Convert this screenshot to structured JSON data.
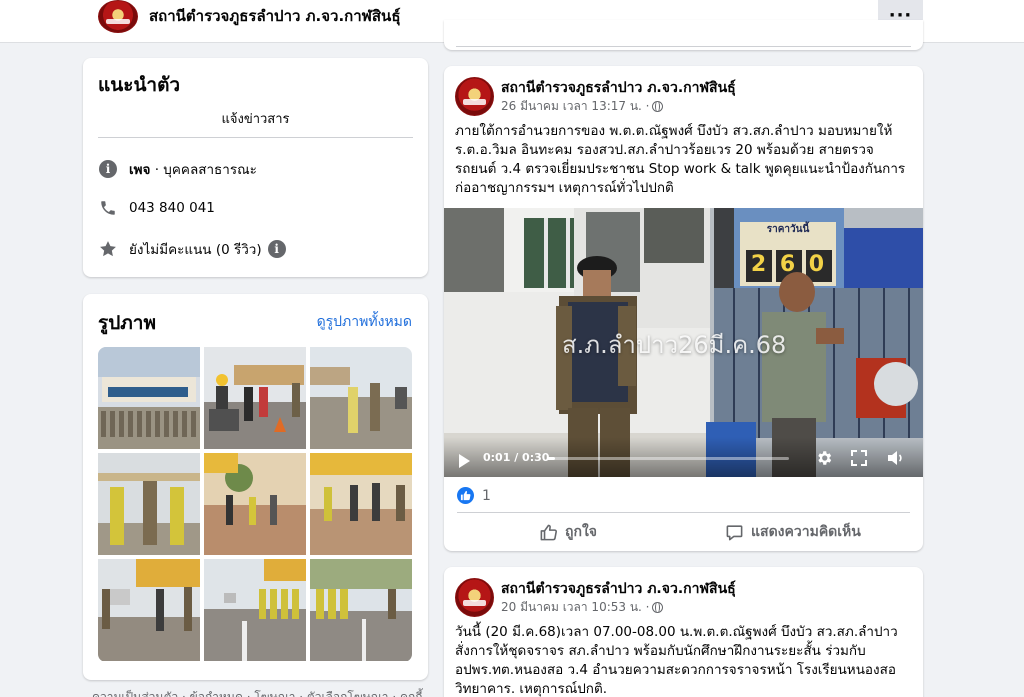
{
  "header": {
    "page_name": "สถานีตำรวจภูธรลำปาว ภ.จว.กาฬสินธุ์",
    "more_label": "···"
  },
  "intro": {
    "title": "แนะนำตัว",
    "subtitle": "แจ้งข่าวสาร",
    "page_type_bold": "เพจ",
    "page_type_rest": " · บุคคลสาธารณะ",
    "phone": "043 840 041",
    "rating": "ยังไม่มีคะแนน (0 รีวิว)"
  },
  "photos": {
    "title": "รูปภาพ",
    "see_all": "ดูรูปภาพทั้งหมด"
  },
  "left_footer": "ความเป็นส่วนตัว · ข้อกำหนด · โฆษณา · ตัวเลือกโฆษณา · คุกกี้",
  "posts": [
    {
      "author": "สถานีตำรวจภูธรลำปาว ภ.จว.กาฬสินธุ์",
      "date": "26 มีนาคม เวลา 13:17 น. ·",
      "text": "ภายใต้การอำนวยการของ พ.ต.ต.ณัฐพงศ์ บึงบัว สว.สภ.ลำปาว มอบหมายให้ ร.ต.อ.วิมล อินทะคม รองสวป.สภ.ลำปาวร้อยเวร 20 พร้อมด้วย สายตรวจรถยนต์ ว.4 ตรวจเยี่ยมประชาชน Stop work & talk พูดคุยแนะนำป้องกันการก่ออาชญากรรมฯ เหตุการณ์ทั่วไปปกติ",
      "video": {
        "overlay": "ส.ภ.ลำปาว26มี.ค.68",
        "time": "0:01 / 0:30",
        "progress": 0.033,
        "price_sign": "ราคาวันนี้",
        "price_digits": "2 6 0"
      },
      "reaction_count": "1",
      "like_label": "ถูกใจ",
      "comment_label": "แสดงความคิดเห็น"
    },
    {
      "author": "สถานีตำรวจภูธรลำปาว ภ.จว.กาฬสินธุ์",
      "date": "20 มีนาคม เวลา 10:53 น. ·",
      "text": "วันนี้ (20 มี.ค.68)เวลา 07.00-08.00 น.พ.ต.ต.ณัฐพงศ์  บึงบัว สว.สภ.ลำปาว สั่งการให้ชุดจราจร สภ.ลำปาว พร้อมกับนักศึกษาฝึกงานระยะสั้น ร่วมกับ อปพร.ทต.หนองสอ ว.4 อำนวยความสะดวกการจราจรหน้า โรงเรียนหนองสอวิทยาคาร. เหตุการณ์ปกติ."
    }
  ]
}
